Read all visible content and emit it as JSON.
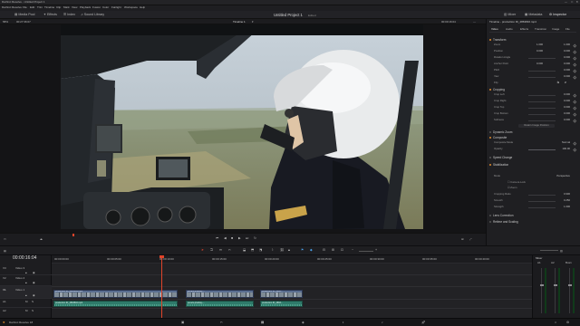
{
  "app": {
    "window_title": "DaVinci Resolve - Untitled Project 1",
    "colors": {
      "accent": "#e08a2a",
      "playhead": "#e0442a",
      "clip_video": "#6a7fa0",
      "clip_audio": "#2f7a6a"
    }
  },
  "menu": [
    "DaVinci Resolve",
    "File",
    "Edit",
    "Trim",
    "Timeline",
    "Clip",
    "Mark",
    "View",
    "Playback",
    "Fusion",
    "Color",
    "Fairlight",
    "Workspace",
    "Help"
  ],
  "toolbar": {
    "media_pool": "Media Pool",
    "effects": "Effects",
    "index": "Index",
    "sound_library": "Sound Library",
    "project_title": "Untitled Project 1",
    "edited": "Edited",
    "mixer": "Mixer",
    "metadata": "Metadata",
    "inspector": "Inspector"
  },
  "viewer": {
    "zoom": "58%",
    "source_tc": "00:27:36:07",
    "timeline_name": "Timeline 1",
    "record_tc": "00:00:16:04"
  },
  "inspector": {
    "header": "Timeline - production ID_4863816.mp4",
    "tabs": [
      "Video",
      "Audio",
      "Effects",
      "Transition",
      "Image",
      "File"
    ],
    "transform": {
      "title": "Transform",
      "rows": [
        {
          "label": "Zoom",
          "x": "1.000",
          "y": "1.000"
        },
        {
          "label": "Position",
          "x": "0.000",
          "y": "0.000"
        },
        {
          "label": "Rotation Angle",
          "x": "0.000"
        },
        {
          "label": "Anchor Point",
          "x": "0.000",
          "y": "0.000"
        },
        {
          "label": "Pitch",
          "x": "0.000"
        },
        {
          "label": "Yaw",
          "x": "0.000"
        },
        {
          "label": "Flip",
          "x": ""
        }
      ]
    },
    "cropping": {
      "title": "Cropping",
      "rows": [
        {
          "label": "Crop Left",
          "x": "0.000"
        },
        {
          "label": "Crop Right",
          "x": "0.000"
        },
        {
          "label": "Crop Top",
          "x": "0.000"
        },
        {
          "label": "Crop Bottom",
          "x": "0.000"
        },
        {
          "label": "Softness",
          "x": "0.000"
        }
      ],
      "retain": "Retain Image Position"
    },
    "dynamic_zoom": "Dynamic Zoom",
    "composite": {
      "title": "Composite",
      "mode_label": "Composite Mode",
      "mode_value": "Normal",
      "opacity_label": "Opacity",
      "opacity_value": "100.00"
    },
    "speed_change": "Speed Change",
    "stabilization": {
      "title": "Stabilization",
      "mode_label": "Mode",
      "mode_value": "Perspective",
      "camera_lock": "Camera Lock",
      "zoom": "Zoom",
      "cropping_ratio": "Cropping Ratio",
      "cropping_ratio_value": "0.900",
      "smooth": "Smooth",
      "smooth_value": "0.250",
      "strength": "Strength",
      "strength_value": "1.000"
    },
    "lens_correction": "Lens Correction",
    "retime_scaling": "Retime and Scaling"
  },
  "timeline": {
    "timecode": "00:00:16:04",
    "ruler": [
      "00:00:00:00",
      "00:00:05:00",
      "00:00:10:00",
      "00:00:15:00",
      "00:00:20:00",
      "00:00:25:00",
      "00:00:30:00",
      "00:00:35:00",
      "00:00:40:00"
    ],
    "tracks": [
      {
        "id": "V3",
        "name": "Video 3"
      },
      {
        "id": "V2",
        "name": "Video 2"
      },
      {
        "id": "V1",
        "name": "Video 1"
      },
      {
        "id": "A1",
        "name": "A1"
      },
      {
        "id": "A2",
        "name": "A2"
      }
    ],
    "clips_video": [
      {
        "name": "production ID_4863816.mp4"
      },
      {
        "name": "pexels-pixabay-..."
      },
      {
        "name": "production ID_4863..."
      }
    ],
    "clips_audio": [
      {
        "name": "production ID_4863816.mp4"
      },
      {
        "name": "pexels-pixabay-..."
      },
      {
        "name": "production ID_4863..."
      }
    ]
  },
  "mixer": {
    "title": "Mixer",
    "channels": [
      "A1",
      "A2",
      "Bus1"
    ]
  },
  "pagebar": {
    "app_label": "DaVinci Resolve 18"
  }
}
